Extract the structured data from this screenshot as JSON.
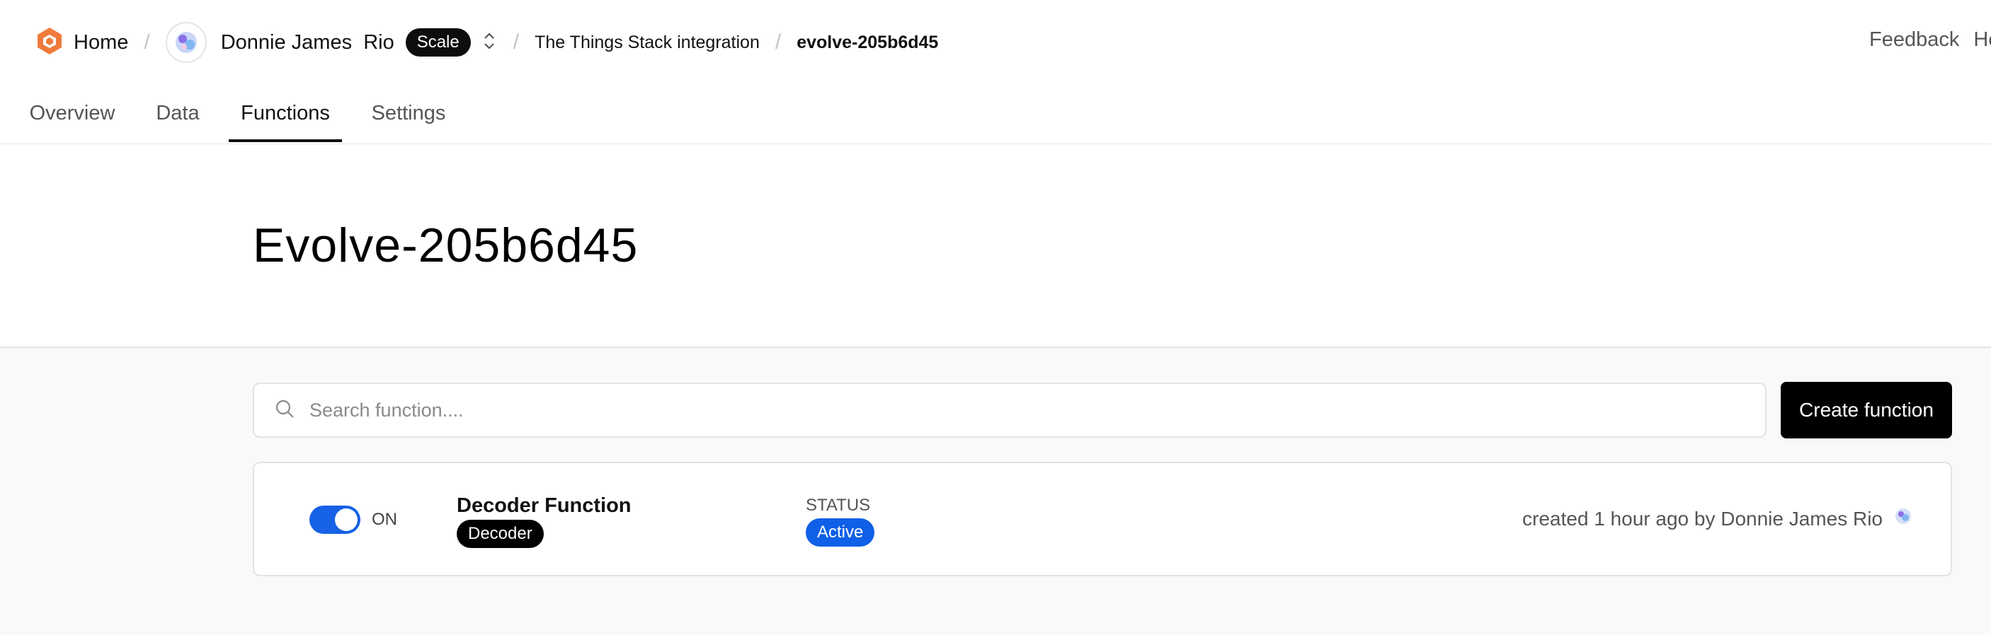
{
  "header": {
    "home_label": "Home",
    "org_name": "Donnie James  Rio",
    "plan_badge": "Scale",
    "app_crumb": "The Things Stack integration",
    "device_crumb": "evolve-205b6d45",
    "separator": "/",
    "right_links": [
      "Feedback",
      "He"
    ]
  },
  "tabs": [
    "Overview",
    "Data",
    "Functions",
    "Settings"
  ],
  "active_tab": "Functions",
  "page": {
    "title": "Evolve-205b6d45"
  },
  "search": {
    "placeholder": "Search function...."
  },
  "create_button": "Create function",
  "functions": [
    {
      "toggle_label": "ON",
      "toggle_on": true,
      "name": "Decoder Function",
      "type": "Decoder",
      "status_label": "STATUS",
      "status": "Active",
      "meta": "created 1 hour ago by Donnie James Rio"
    }
  ],
  "colors": {
    "accent": "#1761e6",
    "logo": "#f07a3c",
    "dark": "#000000"
  },
  "icons": [
    "logo-hexagon-icon",
    "avatar-icon",
    "chevron-updown-icon",
    "search-icon"
  ]
}
